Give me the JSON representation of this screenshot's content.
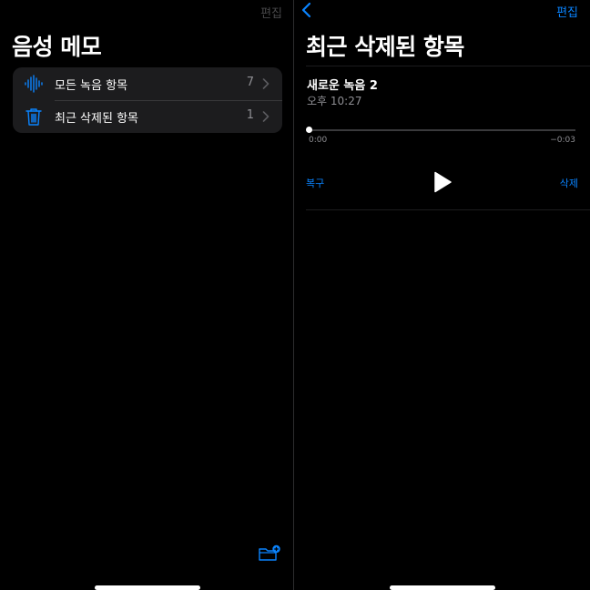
{
  "colors": {
    "accent": "#0a84ff",
    "background": "#000000",
    "card": "#1c1c1e",
    "secondary_text": "#8e8e93",
    "disabled_text": "#48484a"
  },
  "left": {
    "edit_label": "편집",
    "title": "음성 메모",
    "folders": [
      {
        "label": "모든 녹음 항목",
        "count": "7",
        "icon": "waveform-icon"
      },
      {
        "label": "최근 삭제된 항목",
        "count": "1",
        "icon": "trash-icon"
      }
    ],
    "new_folder_icon": "folder-plus-icon"
  },
  "right": {
    "back_icon": "chevron-left-icon",
    "edit_label": "편집",
    "title": "최근 삭제된 항목",
    "recording": {
      "name": "새로운 녹음 2",
      "time": "오후 10:27",
      "elapsed": "0:00",
      "remaining": "−0:03",
      "progress": 0
    },
    "recover_label": "복구",
    "delete_label": "삭제",
    "play_icon": "play-icon"
  }
}
